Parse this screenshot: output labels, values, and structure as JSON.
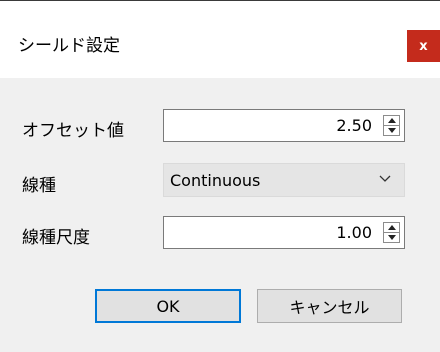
{
  "dialog": {
    "title": "シールド設定",
    "close_label": "x"
  },
  "fields": {
    "offset": {
      "label": "オフセット値",
      "value": "2.50"
    },
    "linetype": {
      "label": "線種",
      "value": "Continuous"
    },
    "linetype_scale": {
      "label": "線種尺度",
      "value": "1.00"
    }
  },
  "buttons": {
    "ok_label": "OK",
    "cancel_label": "キャンセル"
  },
  "colors": {
    "close_button": "#c42b1c",
    "default_button_border": "#0078d7",
    "dialog_background": "#f0f0f0"
  }
}
